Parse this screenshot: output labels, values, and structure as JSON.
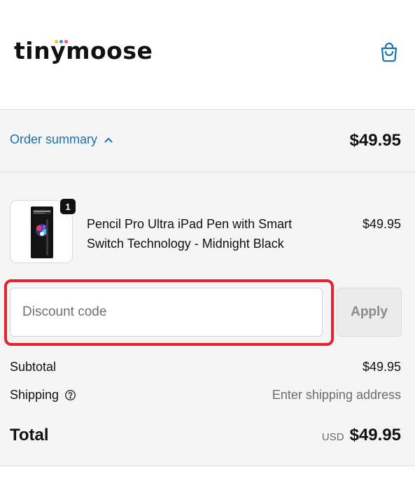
{
  "brand": {
    "name": "tinymoose",
    "dot_colors": [
      "#f5c518",
      "#1e90ff",
      "#ff4d6d"
    ]
  },
  "header": {
    "cart_icon": "shopping-bag-icon"
  },
  "summary": {
    "toggle_label": "Order summary",
    "toggle_icon": "chevron-up-icon",
    "total": "$49.95"
  },
  "line_items": [
    {
      "title": "Pencil Pro Ultra iPad Pen with Smart Switch Technology - Midnight Black",
      "price": "$49.95",
      "quantity": "1"
    }
  ],
  "discount": {
    "placeholder": "Discount code",
    "value": "",
    "apply_label": "Apply",
    "highlight_color": "#e8222c"
  },
  "totals": {
    "subtotal_label": "Subtotal",
    "subtotal_value": "$49.95",
    "shipping_label": "Shipping",
    "shipping_icon": "question-circle-icon",
    "shipping_value": "Enter shipping address",
    "total_label": "Total",
    "currency": "USD",
    "total_value": "$49.95"
  },
  "colors": {
    "link": "#1773b0",
    "panel_bg": "#f5f5f5",
    "border": "#dedede"
  }
}
